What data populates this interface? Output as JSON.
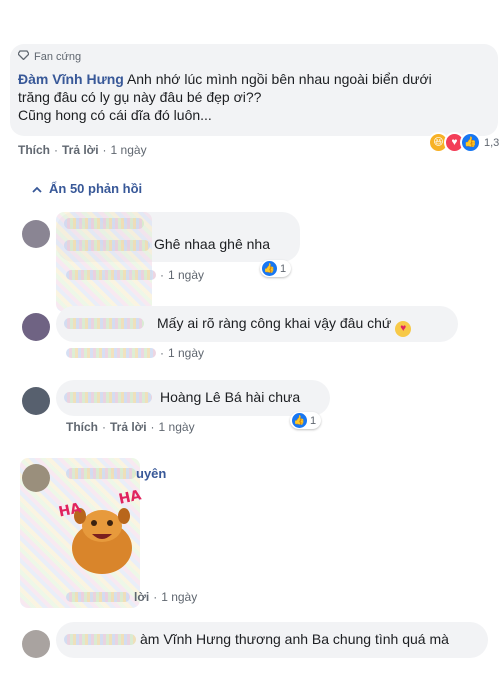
{
  "top_comment": {
    "badge": "Fan cứng",
    "author": "Đàm Vĩnh Hưng",
    "text_line1": "Anh nhớ lúc mình ngồi bên nhau ngoài biển dưới",
    "text_line2": "trăng đâu có ly gụ này đâu bé đẹp ơi??",
    "text_line3": "Cũng hong có cái dĩa đó luôn...",
    "like_label": "Thích",
    "reply_label": "Trả lời",
    "time": "1 ngày",
    "reaction_count": "1,3",
    "reactions": [
      "haha-icon",
      "love-icon",
      "like-icon"
    ]
  },
  "replies_toggle": {
    "label": "Ẩn 50 phản hồi"
  },
  "replies": [
    {
      "text": "Ghê nhaa ghê nha",
      "time": "1 ngày",
      "like_count": "1"
    },
    {
      "text": "Mấy ai rõ ràng công khai vậy đâu chứ",
      "time": "1 ngày"
    },
    {
      "text": "Hoàng Lê Bá hài chưa",
      "like_label": "Thích",
      "reply_label": "Trả lời",
      "time": "1 ngày",
      "like_count": "1"
    },
    {
      "name_tail": "uyên",
      "sticker_text": "HA HA",
      "time_prefix": "lời",
      "time": "1 ngày"
    },
    {
      "text": "àm Vĩnh Hưng thương anh Ba chung tình quá mà"
    }
  ],
  "colors": {
    "link": "#385898",
    "like": "#1877f2",
    "bubble": "#f2f3f5"
  }
}
